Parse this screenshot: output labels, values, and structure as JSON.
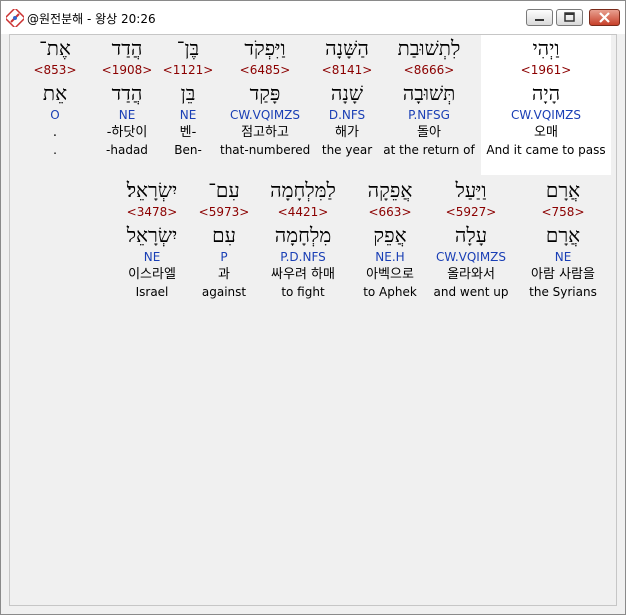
{
  "window": {
    "title": "@원전분해 - 왕상 20:26",
    "controls": [
      "minimize",
      "maximize",
      "close"
    ]
  },
  "rows": [
    {
      "words": [
        {
          "heb": "וַיְהִי",
          "strong": "<1961>",
          "lemma": "הָיָה",
          "parse": "CW.VQIMZS",
          "kor": "오매",
          "eng": "And it came to pass",
          "highlight": true
        },
        {
          "heb": "לִתְשׁוּבַת",
          "strong": "<8666>",
          "lemma": "תְּשׁוּבָה",
          "parse": "P.NFSG",
          "kor": "돌아",
          "eng": "at the return of"
        },
        {
          "heb": "הַשָּׁנָה",
          "strong": "<8141>",
          "lemma": "שָׁנָה",
          "parse": "D.NFS",
          "kor": "해가",
          "eng": "the year"
        },
        {
          "heb": "וַיִּפְקֹד",
          "strong": "<6485>",
          "lemma": "פָּקַד",
          "parse": "CW.VQIMZS",
          "kor": "점고하고",
          "eng": "that-numbered"
        },
        {
          "heb": "בֶּן־",
          "strong": "<1121>",
          "lemma": "בֵּן",
          "parse": "NE",
          "kor": "벤-",
          "eng": "Ben-"
        },
        {
          "heb": "הֲדַד",
          "strong": "<1908>",
          "lemma": "הֲדַד",
          "parse": "NE",
          "kor": "-하닷이",
          "eng": "-hadad"
        },
        {
          "heb": "אֶת־",
          "strong": "<853>",
          "lemma": "אֵת",
          "parse": "O",
          "kor": ".",
          "eng": "."
        }
      ]
    },
    {
      "words": [
        {
          "heb": "אֲרָם",
          "strong": "<758>",
          "lemma": "אֲרָם",
          "parse": "NE",
          "kor": "아람 사람을",
          "eng": "the Syrians"
        },
        {
          "heb": "וַיַּעַל",
          "strong": "<5927>",
          "lemma": "עָלָה",
          "parse": "CW.VQIMZS",
          "kor": "올라와서",
          "eng": "and went up"
        },
        {
          "heb": "אֲפֵקָה",
          "strong": "<663>",
          "lemma": "אֲפֵק",
          "parse": "NE.H",
          "kor": "아벡으로",
          "eng": "to Aphek"
        },
        {
          "heb": "לַמִּלְחָמָה",
          "strong": "<4421>",
          "lemma": "מִלְחָמָה",
          "parse": "P.D.NFS",
          "kor": "싸우려 하매",
          "eng": "to fight"
        },
        {
          "heb": "עִם־",
          "strong": "<5973>",
          "lemma": "עִם",
          "parse": "P",
          "kor": "과",
          "eng": "against"
        },
        {
          "heb": "יִשְׂרָאֵל׃",
          "strong": "<3478>",
          "lemma": "יִשְׂרָאֵל",
          "parse": "NE",
          "kor": "이스라엘",
          "eng": "Israel"
        }
      ]
    }
  ]
}
